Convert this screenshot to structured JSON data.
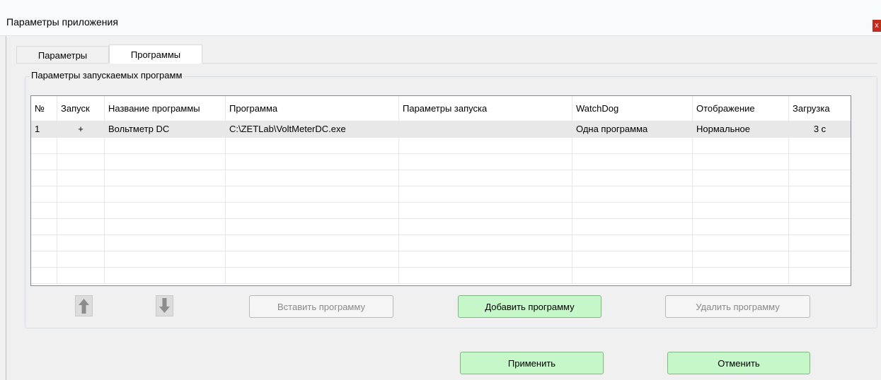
{
  "window": {
    "title": "Параметры приложения",
    "close_label": "x"
  },
  "tabs": [
    {
      "label": "Параметры",
      "active": false
    },
    {
      "label": "Программы",
      "active": true
    }
  ],
  "group": {
    "title": "Параметры запускаемых программ"
  },
  "table": {
    "columns": [
      "№",
      "Запуск",
      "Название программы",
      "Программа",
      "Параметры запуска",
      "WatchDog",
      "Отображение",
      "Загрузка"
    ],
    "rows": [
      {
        "num": "1",
        "launch": "+",
        "name": "Вольтметр DC",
        "program": "C:\\ZETLab\\VoltMeterDC.exe",
        "params": "",
        "watchdog": "Одна программа",
        "display": "Нормальное",
        "load": "3 с"
      }
    ]
  },
  "buttons": {
    "move_up_icon": "arrow-up-icon",
    "move_down_icon": "arrow-down-icon",
    "insert": "Вставить программу",
    "add": "Добавить программу",
    "delete": "Удалить программу",
    "apply": "Применить",
    "cancel": "Отменить"
  },
  "colors": {
    "accent_green": "#c5f7c8",
    "close_red": "#c42b1c",
    "selected_row": "#e8e8e8"
  }
}
